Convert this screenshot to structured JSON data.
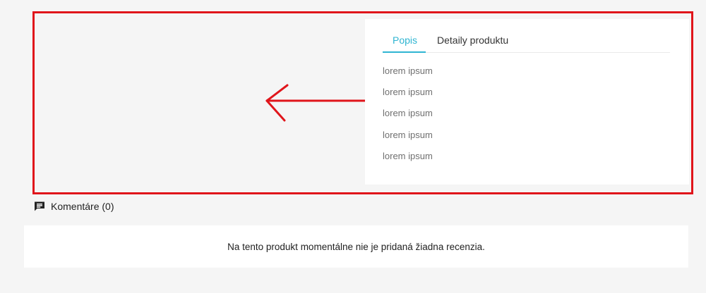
{
  "tabs": [
    {
      "label": "Popis"
    },
    {
      "label": "Detaily produktu"
    }
  ],
  "description_lines": [
    "lorem ipsum",
    "lorem ipsum",
    "lorem ipsum",
    "lorem ipsum",
    "lorem ipsum"
  ],
  "comments": {
    "heading": "Komentáre (0)",
    "empty_message": "Na tento produkt momentálne nie je pridaná žiadna recenzia."
  },
  "annotation": {
    "color": "#e0151b"
  },
  "accent_color": "#2fb5d2",
  "icons": {
    "comments": "comment-icon"
  }
}
